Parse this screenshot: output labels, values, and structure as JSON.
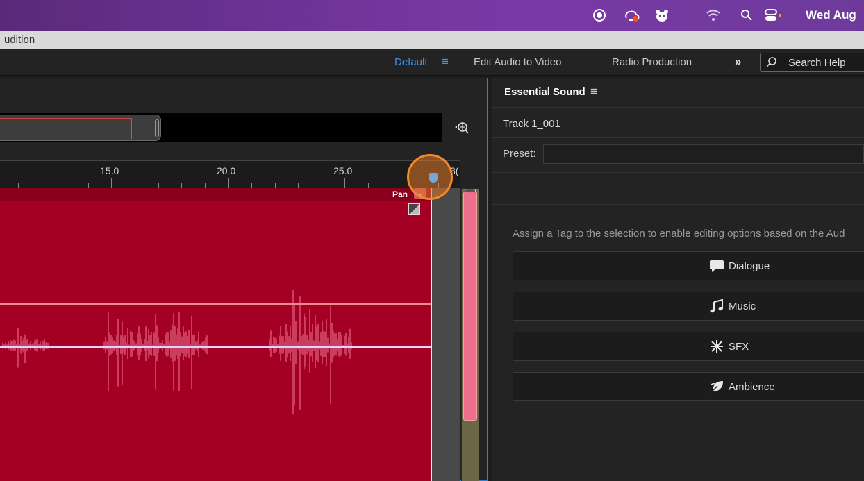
{
  "menubar": {
    "date": "Wed Aug",
    "icons": [
      "record-icon",
      "creative-cloud-icon",
      "bear-icon",
      "wifi-icon",
      "search-icon",
      "control-center-icon"
    ]
  },
  "titlebar": {
    "app_name": "udition"
  },
  "workspaces": {
    "items": [
      {
        "label": "Default",
        "active": true
      },
      {
        "label": "Edit Audio to Video",
        "active": false
      },
      {
        "label": "Radio Production",
        "active": false
      }
    ],
    "more": "»",
    "search_label": "Search Help"
  },
  "editor": {
    "ruler": {
      "labels": [
        "15.0",
        "20.0",
        "25.0",
        "3("
      ]
    },
    "track": {
      "pan_label": "Pan"
    },
    "meter_level": 0.79
  },
  "essential_sound": {
    "title": "Essential Sound",
    "track_name": "Track 1_001",
    "preset_label": "Preset:",
    "preset_value": "",
    "assign_text": "Assign a Tag to the selection to enable editing options based on the Aud",
    "tags": [
      {
        "label": "Dialogue",
        "icon": "speech-bubble-icon"
      },
      {
        "label": "Music",
        "icon": "music-note-icon"
      },
      {
        "label": "SFX",
        "icon": "burst-icon"
      },
      {
        "label": "Ambience",
        "icon": "leaf-icon"
      }
    ]
  },
  "colors": {
    "accent": "#3b93e8",
    "track": "#a40023",
    "waveform": "#f07a9a",
    "highlight": "#f08a2a"
  }
}
